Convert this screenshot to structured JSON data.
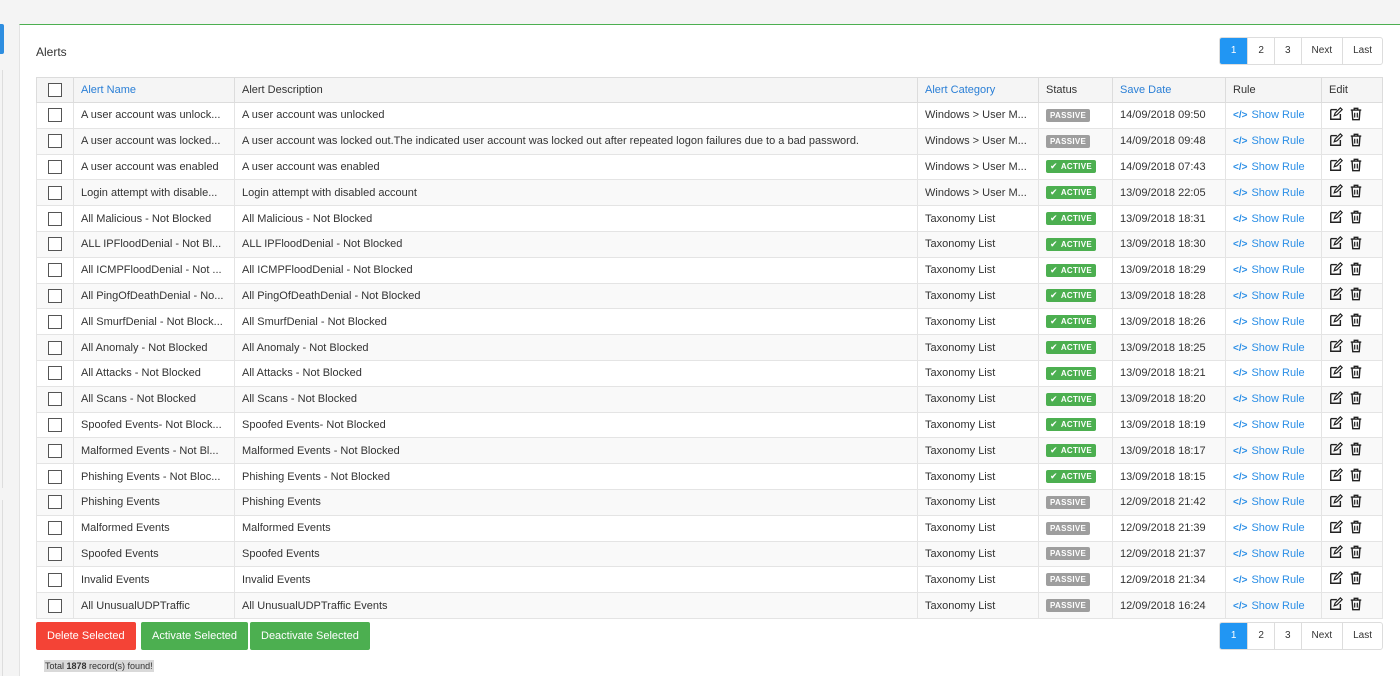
{
  "panel": {
    "title": "Alerts"
  },
  "pagination": {
    "pages": [
      "1",
      "2",
      "3"
    ],
    "next": "Next",
    "last": "Last",
    "active": "1"
  },
  "table": {
    "headers": {
      "alert_name": "Alert Name",
      "alert_description": "Alert Description",
      "alert_category": "Alert Category",
      "status": "Status",
      "save_date": "Save Date",
      "rule": "Rule",
      "edit": "Edit"
    },
    "show_rule_label": "Show Rule",
    "rows": [
      {
        "name": "A user account was unlock...",
        "description": "A user account was unlocked",
        "category": "Windows > User M...",
        "status": "PASSIVE",
        "date": "14/09/2018 09:50"
      },
      {
        "name": "A user account was locked...",
        "description": "A user account was locked out.The indicated user account was locked out after repeated logon failures due to a bad password.",
        "category": "Windows > User M...",
        "status": "PASSIVE",
        "date": "14/09/2018 09:48"
      },
      {
        "name": "A user account was enabled",
        "description": "A user account was enabled",
        "category": "Windows > User M...",
        "status": "ACTIVE",
        "date": "14/09/2018 07:43"
      },
      {
        "name": "Login attempt with disable...",
        "description": "Login attempt with disabled account",
        "category": "Windows > User M...",
        "status": "ACTIVE",
        "date": "13/09/2018 22:05"
      },
      {
        "name": "All Malicious - Not Blocked",
        "description": "All Malicious - Not Blocked",
        "category": "Taxonomy List",
        "status": "ACTIVE",
        "date": "13/09/2018 18:31"
      },
      {
        "name": "ALL IPFloodDenial - Not Bl...",
        "description": "ALL IPFloodDenial - Not Blocked",
        "category": "Taxonomy List",
        "status": "ACTIVE",
        "date": "13/09/2018 18:30"
      },
      {
        "name": "All ICMPFloodDenial - Not ...",
        "description": "All ICMPFloodDenial - Not Blocked",
        "category": "Taxonomy List",
        "status": "ACTIVE",
        "date": "13/09/2018 18:29"
      },
      {
        "name": "All PingOfDeathDenial - No...",
        "description": "All PingOfDeathDenial - Not Blocked",
        "category": "Taxonomy List",
        "status": "ACTIVE",
        "date": "13/09/2018 18:28"
      },
      {
        "name": "All SmurfDenial - Not Block...",
        "description": "All SmurfDenial - Not Blocked",
        "category": "Taxonomy List",
        "status": "ACTIVE",
        "date": "13/09/2018 18:26"
      },
      {
        "name": "All Anomaly - Not Blocked",
        "description": "All Anomaly - Not Blocked",
        "category": "Taxonomy List",
        "status": "ACTIVE",
        "date": "13/09/2018 18:25"
      },
      {
        "name": "All Attacks - Not Blocked",
        "description": "All Attacks - Not Blocked",
        "category": "Taxonomy List",
        "status": "ACTIVE",
        "date": "13/09/2018 18:21"
      },
      {
        "name": "All Scans - Not Blocked",
        "description": "All Scans - Not Blocked",
        "category": "Taxonomy List",
        "status": "ACTIVE",
        "date": "13/09/2018 18:20"
      },
      {
        "name": "Spoofed Events- Not Block...",
        "description": "Spoofed Events- Not Blocked",
        "category": "Taxonomy List",
        "status": "ACTIVE",
        "date": "13/09/2018 18:19"
      },
      {
        "name": "Malformed Events - Not Bl...",
        "description": "Malformed Events - Not Blocked",
        "category": "Taxonomy List",
        "status": "ACTIVE",
        "date": "13/09/2018 18:17"
      },
      {
        "name": "Phishing Events - Not Bloc...",
        "description": "Phishing Events - Not Blocked",
        "category": "Taxonomy List",
        "status": "ACTIVE",
        "date": "13/09/2018 18:15"
      },
      {
        "name": "Phishing Events",
        "description": "Phishing Events",
        "category": "Taxonomy List",
        "status": "PASSIVE",
        "date": "12/09/2018 21:42"
      },
      {
        "name": "Malformed Events",
        "description": "Malformed Events",
        "category": "Taxonomy List",
        "status": "PASSIVE",
        "date": "12/09/2018 21:39"
      },
      {
        "name": "Spoofed Events",
        "description": "Spoofed Events",
        "category": "Taxonomy List",
        "status": "PASSIVE",
        "date": "12/09/2018 21:37"
      },
      {
        "name": "Invalid Events",
        "description": "Invalid Events",
        "category": "Taxonomy List",
        "status": "PASSIVE",
        "date": "12/09/2018 21:34"
      },
      {
        "name": "All UnusualUDPTraffic",
        "description": "All UnusualUDPTraffic Events",
        "category": "Taxonomy List",
        "status": "PASSIVE",
        "date": "12/09/2018 16:24"
      }
    ]
  },
  "actions": {
    "delete_label": "Delete Selected",
    "activate_label": "Activate Selected",
    "deactivate_label": "Deactivate Selected"
  },
  "footer": {
    "prefix": "Total ",
    "count": "1878",
    "suffix": " record(s) found!"
  },
  "colors": {
    "primary": "#2196f3",
    "active": "#4caf50",
    "passive": "#9e9e9e",
    "danger": "#f44336",
    "link": "#2a8ee6"
  },
  "icons": {
    "edit": "edit-icon",
    "delete": "trash-icon",
    "code": "code-icon",
    "check": "check-icon"
  }
}
